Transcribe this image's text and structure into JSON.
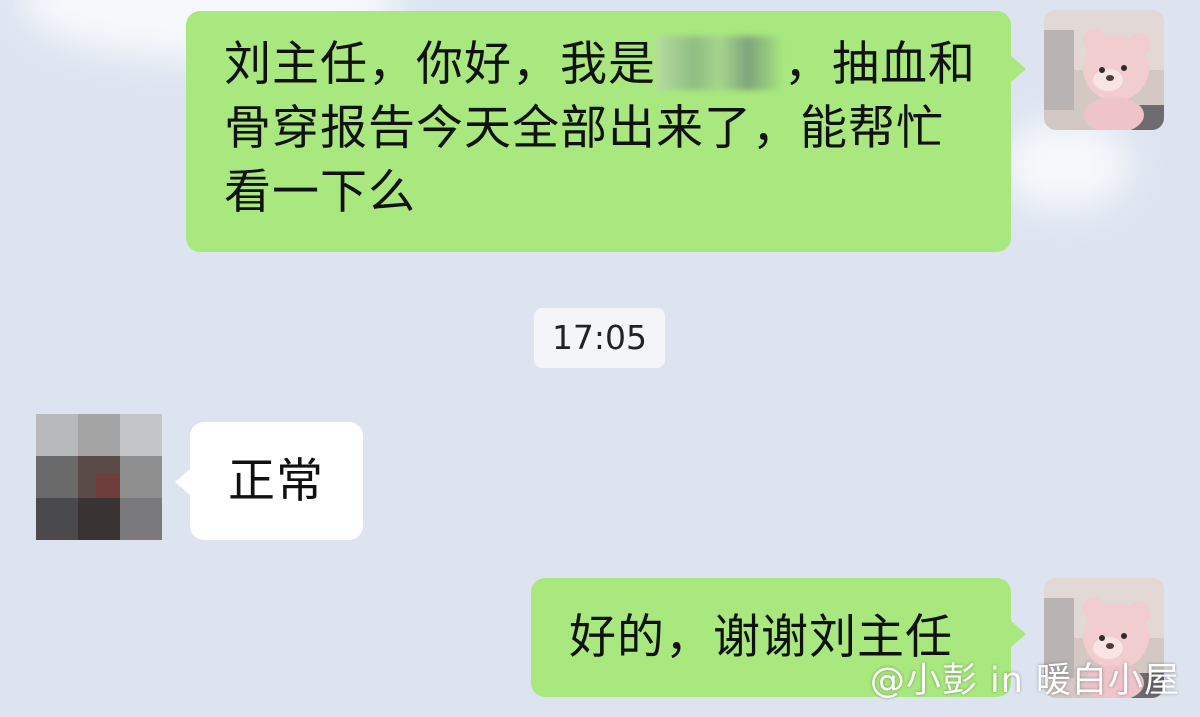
{
  "messages": [
    {
      "sender": "me",
      "text_before": "刘主任，你好，我是",
      "text_after": "，抽血和骨穿报告今天全部出来了，能帮忙看一下么"
    },
    {
      "sender": "doctor",
      "text": "正常"
    },
    {
      "sender": "me",
      "text": "好的，谢谢刘主任"
    }
  ],
  "timestamp": "17:05",
  "watermark": "@小彭 in 暖白小屋",
  "colors": {
    "background": "#dde4f0",
    "my_bubble": "#a9e87e",
    "their_bubble": "#ffffff"
  },
  "icons": {
    "my_avatar": "pink-bear-photo",
    "doctor_avatar": "pixelated-photo"
  }
}
